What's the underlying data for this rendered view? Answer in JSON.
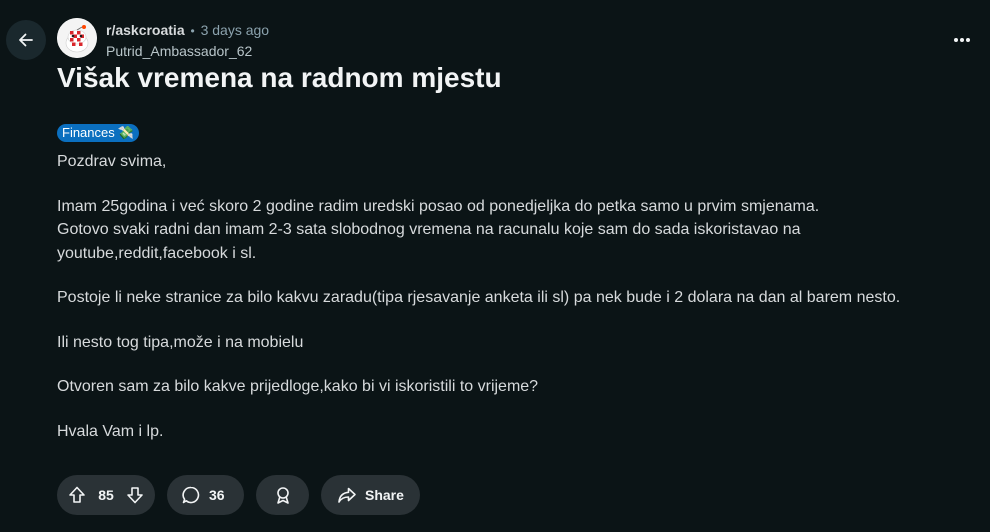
{
  "header": {
    "back_icon": "arrow-left-icon",
    "subreddit": "r/askcroatia",
    "separator": "•",
    "time_ago": "3 days ago",
    "author": "Putrid_Ambassador_62",
    "more_icon": "more-horizontal-icon"
  },
  "post": {
    "title": "Višak vremena na radnom mjestu",
    "flair": {
      "label": "Finances",
      "emoji": "💸",
      "color": "#0b6fbf"
    },
    "paragraphs": [
      [
        "Pozdrav svima,"
      ],
      [
        "Imam 25godina i već skoro 2 godine radim uredski posao od ponedjeljka do petka samo u prvim smjenama.",
        "Gotovo svaki radni dan imam 2-3 sata slobodnog vremena na racunalu koje sam do sada iskoristavao na",
        "youtube,reddit,facebook i sl."
      ],
      [
        "Postoje li neke stranice za bilo kakvu zaradu(tipa rjesavanje anketa ili sl) pa nek bude i 2 dolara na dan al barem nesto."
      ],
      [
        "Ili nesto tog tipa,može i na mobielu"
      ],
      [
        "Otvoren sam za bilo kakve prijedloge,kako bi vi iskoristili to vrijeme?"
      ],
      [
        "Hvala Vam i lp."
      ]
    ]
  },
  "actions": {
    "upvote_icon": "upvote-arrow-icon",
    "score": "85",
    "downvote_icon": "downvote-arrow-icon",
    "comment_icon": "comment-bubble-icon",
    "comments": "36",
    "award_icon": "award-ribbon-icon",
    "share_icon": "share-arrow-icon",
    "share_label": "Share"
  },
  "colors": {
    "background": "#0b1416",
    "pill": "#2a3236",
    "flair": "#0b6fbf"
  }
}
